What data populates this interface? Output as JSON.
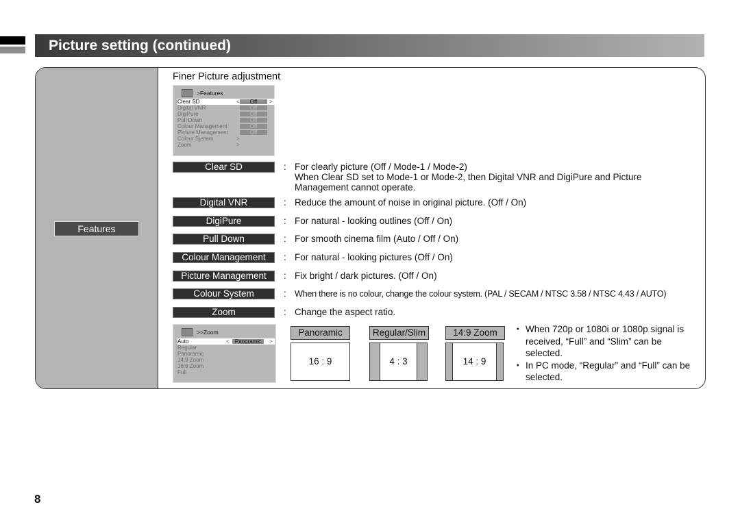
{
  "header": {
    "title": "Picture setting (continued)"
  },
  "sidebar": {
    "section": "Features"
  },
  "main": {
    "subtitle": "Finer Picture adjustment",
    "features_menu": {
      "icon": "menu-picture-icon",
      "title": ">Features",
      "items": [
        {
          "label": "Clear SD",
          "value": "Off",
          "selected": true
        },
        {
          "label": "Digital VNR",
          "value": "Off"
        },
        {
          "label": "DigiPure",
          "value": "Off"
        },
        {
          "label": "Pull Down",
          "value": "Off"
        },
        {
          "label": "Colour Management",
          "value": "Off"
        },
        {
          "label": "Picture Management",
          "value": "Off"
        },
        {
          "label": "Colour System",
          "arrow": ">"
        },
        {
          "label": "Zoom",
          "arrow": ">"
        }
      ]
    },
    "settings": [
      {
        "label": "Clear SD",
        "desc": "For clearly picture (Off / Mode-1 / Mode-2)",
        "desc2": "When Clear SD set to Mode-1 or Mode-2, then Digital VNR and DigiPure and Picture",
        "desc3": "Management cannot operate."
      },
      {
        "label": "Digital VNR",
        "desc": "Reduce the amount of noise in original picture. (Off / On)"
      },
      {
        "label": "DigiPure",
        "desc": "For natural - looking outlines (Off / On)"
      },
      {
        "label": "Pull Down",
        "desc": "For smooth cinema film (Auto / Off / On)"
      },
      {
        "label": "Colour Management",
        "desc": "For natural - looking pictures (Off / On)"
      },
      {
        "label": "Picture Management",
        "desc": "Fix bright / dark pictures. (Off / On)"
      },
      {
        "label": "Colour System",
        "desc": "When there is no colour, change the colour system. (PAL / SECAM / NTSC 3.58 / NTSC 4.43 / AUTO)"
      },
      {
        "label": "Zoom",
        "desc": "Change the aspect ratio."
      }
    ],
    "colon": ":",
    "zoom_menu": {
      "icon": "menu-picture-icon",
      "title": ">>Zoom",
      "items": [
        {
          "label": "Auto",
          "value": "Panoramic",
          "selected": true
        },
        {
          "label": "Regular"
        },
        {
          "label": "Panoramic"
        },
        {
          "label": "14:9 Zoom"
        },
        {
          "label": "16:9 Zoom"
        },
        {
          "label": "Full"
        }
      ],
      "left_arrow": "<",
      "right_arrow": ">"
    },
    "aspect_modes": [
      {
        "label": "Panoramic",
        "ratio": "16 : 9"
      },
      {
        "label": "Regular/Slim",
        "ratio": "4 : 3"
      },
      {
        "label": "14:9 Zoom",
        "ratio": "14 : 9"
      }
    ],
    "notes": [
      "When 720p or 1080i or 1080p signal is received, “Full” and “Slim” can be selected.",
      "In PC mode, “Regular” and “Full” can be selected."
    ]
  },
  "footer": {
    "page_number": "8"
  }
}
